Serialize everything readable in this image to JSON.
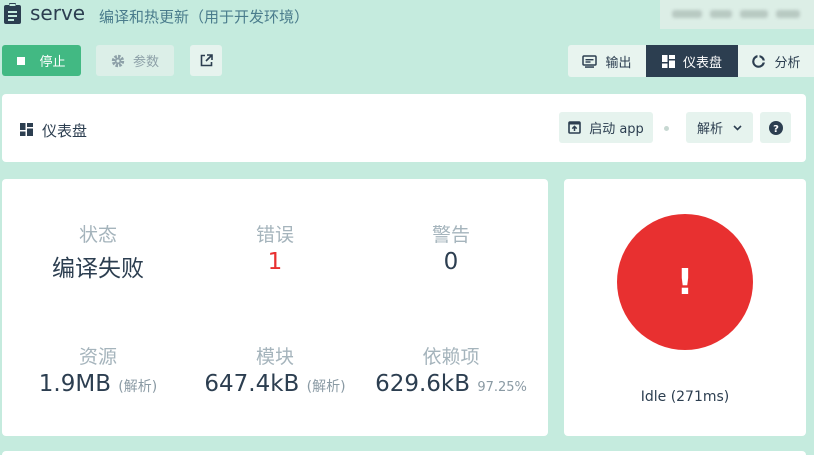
{
  "header": {
    "title": "serve",
    "subtitle": "编译和热更新（用于开发环境）",
    "icon": "clipboard-icon"
  },
  "toolbar": {
    "stop_label": "停止",
    "params_label": "参数",
    "output_label": "输出",
    "dashboard_label": "仪表盘",
    "analyze_label": "分析"
  },
  "panel": {
    "title": "仪表盘",
    "start_app_label": "启动 app",
    "mode_label": "解析",
    "help_label": "?"
  },
  "stats": {
    "status": {
      "label": "状态",
      "value": "编译失败"
    },
    "errors": {
      "label": "错误",
      "value": "1"
    },
    "warnings": {
      "label": "警告",
      "value": "0"
    },
    "assets": {
      "label": "资源",
      "value": "1.9MB",
      "note": "(解析)"
    },
    "modules": {
      "label": "模块",
      "value": "647.4kB",
      "note": "(解析)"
    },
    "deps": {
      "label": "依赖项",
      "value": "629.6kB",
      "note": "97.25%"
    }
  },
  "status_card": {
    "symbol": "!",
    "idle_text": "Idle (271ms)"
  },
  "colors": {
    "background": "#c5ebde",
    "accent": "#42b983",
    "dark": "#2c3e50",
    "error": "#e83030"
  }
}
